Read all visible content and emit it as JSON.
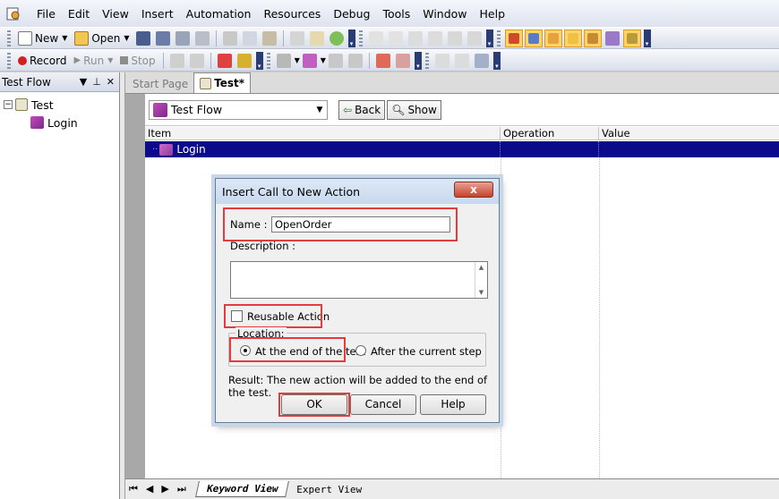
{
  "menu": {
    "items": [
      {
        "label": "File",
        "key": "F"
      },
      {
        "label": "Edit",
        "key": "E"
      },
      {
        "label": "View",
        "key": "V"
      },
      {
        "label": "Insert",
        "key": "I"
      },
      {
        "label": "Automation",
        "key": "A"
      },
      {
        "label": "Resources",
        "key": "R"
      },
      {
        "label": "Debug",
        "key": "D"
      },
      {
        "label": "Tools",
        "key": "T"
      },
      {
        "label": "Window",
        "key": "W"
      },
      {
        "label": "Help",
        "key": "H"
      }
    ]
  },
  "toolbar": {
    "new_label": "New",
    "open_label": "Open",
    "record_label": "Record",
    "run_label": "Run",
    "stop_label": "Stop"
  },
  "left_pane": {
    "title": "Test Flow",
    "tree": {
      "root": "Test",
      "child": "Login"
    }
  },
  "doc_tabs": {
    "start_page": "Start Page",
    "test": "Test*"
  },
  "editor": {
    "flow_combo": "Test Flow",
    "back_label": "Back",
    "show_label": "Show",
    "columns": [
      "Item",
      "Operation",
      "Value"
    ],
    "rows": [
      {
        "item": "Login",
        "operation": "",
        "value": ""
      }
    ]
  },
  "bottom_tabs": {
    "keyword_view": "Keyword View",
    "expert_view": "Expert View"
  },
  "dialog": {
    "title": "Insert Call to New Action",
    "close": "x",
    "name_label": "Name :",
    "name_value": "OpenOrder",
    "description_label": "Description :",
    "reusable_label": "Reusable Action",
    "location_label": "Location:",
    "location_end": "At the end of the test",
    "location_after": "After the current step",
    "result_text": "Result: The new action will be added to the end of the test.",
    "ok": "OK",
    "cancel": "Cancel",
    "help": "Help"
  },
  "colors": {
    "selected_row": "#0a0a8a",
    "highlight_box": "#e23c3c"
  }
}
